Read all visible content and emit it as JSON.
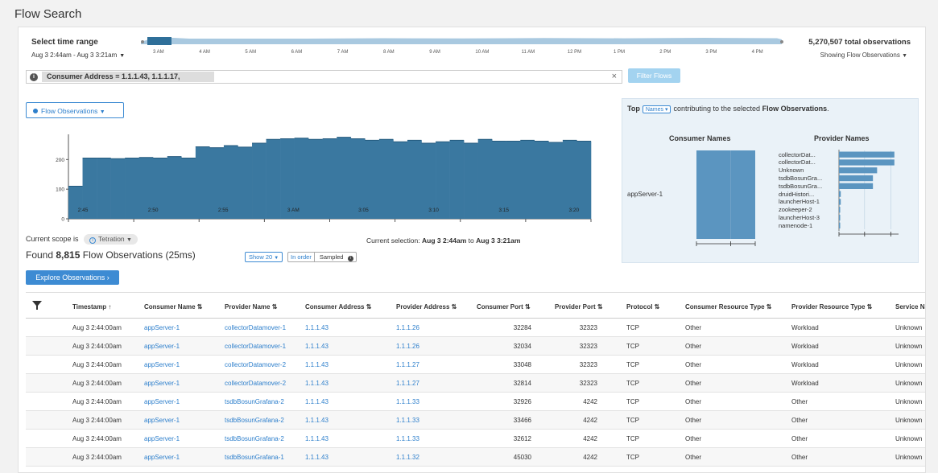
{
  "page_title": "Flow Search",
  "time_range": {
    "label": "Select time range",
    "value": "Aug 3 2:44am - Aug 3 3:21am",
    "ticks": [
      "3 AM",
      "4 AM",
      "5 AM",
      "6 AM",
      "7 AM",
      "8 AM",
      "9 AM",
      "10 AM",
      "11 AM",
      "12 PM",
      "1 PM",
      "2 PM",
      "3 PM",
      "4 PM"
    ],
    "total": "5,270,507 total observations",
    "showing": "Showing Flow Observations"
  },
  "filter": {
    "chip": "Consumer Address  =  1.1.1.43, 1.1.1.17,",
    "clear": "×",
    "button": "Filter Flows"
  },
  "metric_dropdown": "Flow Observations",
  "chart_data": {
    "type": "bar",
    "yticks": [
      0,
      100,
      200
    ],
    "ylim": [
      0,
      285
    ],
    "xticks": [
      "2:45",
      "2:50",
      "2:55",
      "3 AM",
      "3:05",
      "3:10",
      "3:15",
      "3:20"
    ],
    "values": [
      110,
      205,
      205,
      203,
      205,
      207,
      205,
      210,
      205,
      243,
      240,
      247,
      242,
      255,
      268,
      270,
      272,
      268,
      270,
      275,
      270,
      265,
      268,
      260,
      265,
      255,
      260,
      265,
      255,
      268,
      262,
      262,
      265,
      262,
      258,
      265,
      262
    ]
  },
  "scope": {
    "label": "Current scope is",
    "value": "Tetration"
  },
  "selection": {
    "prefix": "Current selection:",
    "start": "Aug 3 2:44am",
    "to": "to",
    "end": "Aug 3 3:21am"
  },
  "found": {
    "prefix": "Found",
    "count": "8,815",
    "suffix": "Flow Observations (25ms)"
  },
  "controls": {
    "show": "Show 20",
    "in_order": "In order",
    "sampled": "Sampled"
  },
  "explore_button": "Explore Observations",
  "top_panel": {
    "top": "Top",
    "select": "Names",
    "middle": "contributing to the selected",
    "metric": "Flow Observations",
    "consumer_title": "Consumer Names",
    "provider_title": "Provider Names",
    "consumer_item": "appServer-1",
    "consumer_values": [
      1
    ],
    "providers": [
      "collectorDat...",
      "collectorDat...",
      "Unknown",
      "tsdbBosunGra...",
      "tsdbBosunGra...",
      "druidHistori...",
      "launcherHost-1",
      "zookeeper-2",
      "launcherHost-3",
      "namenode-1"
    ],
    "provider_values": [
      0.93,
      0.93,
      0.64,
      0.57,
      0.57,
      0.03,
      0.03,
      0.02,
      0.02,
      0.02
    ]
  },
  "table": {
    "headers": [
      "Timestamp ↑",
      "Consumer Name ⇅",
      "Provider Name ⇅",
      "Consumer Address ⇅",
      "Provider Address ⇅",
      "Consumer Port ⇅",
      "Provider Port ⇅",
      "Protocol ⇅",
      "Consumer Resource Type ⇅",
      "Provider Resource Type ⇅",
      "Service Name"
    ],
    "rows": [
      [
        "Aug 3 2:44:00am",
        "appServer-1",
        "collectorDatamover-1",
        "1.1.1.43",
        "1.1.1.26",
        "32284",
        "32323",
        "TCP",
        "Other",
        "Workload",
        "Unknown"
      ],
      [
        "Aug 3 2:44:00am",
        "appServer-1",
        "collectorDatamover-1",
        "1.1.1.43",
        "1.1.1.26",
        "32034",
        "32323",
        "TCP",
        "Other",
        "Workload",
        "Unknown"
      ],
      [
        "Aug 3 2:44:00am",
        "appServer-1",
        "collectorDatamover-2",
        "1.1.1.43",
        "1.1.1.27",
        "33048",
        "32323",
        "TCP",
        "Other",
        "Workload",
        "Unknown"
      ],
      [
        "Aug 3 2:44:00am",
        "appServer-1",
        "collectorDatamover-2",
        "1.1.1.43",
        "1.1.1.27",
        "32814",
        "32323",
        "TCP",
        "Other",
        "Workload",
        "Unknown"
      ],
      [
        "Aug 3 2:44:00am",
        "appServer-1",
        "tsdbBosunGrafana-2",
        "1.1.1.43",
        "1.1.1.33",
        "32926",
        "4242",
        "TCP",
        "Other",
        "Other",
        "Unknown"
      ],
      [
        "Aug 3 2:44:00am",
        "appServer-1",
        "tsdbBosunGrafana-2",
        "1.1.1.43",
        "1.1.1.33",
        "33466",
        "4242",
        "TCP",
        "Other",
        "Other",
        "Unknown"
      ],
      [
        "Aug 3 2:44:00am",
        "appServer-1",
        "tsdbBosunGrafana-2",
        "1.1.1.43",
        "1.1.1.33",
        "32612",
        "4242",
        "TCP",
        "Other",
        "Other",
        "Unknown"
      ],
      [
        "Aug 3 2:44:00am",
        "appServer-1",
        "tsdbBosunGrafana-1",
        "1.1.1.43",
        "1.1.1.32",
        "45030",
        "4242",
        "TCP",
        "Other",
        "Other",
        "Unknown"
      ]
    ]
  },
  "colors": {
    "bar": "#3a78a0",
    "accent": "#3d8bd3",
    "panel_bar": "#5b95c0"
  }
}
